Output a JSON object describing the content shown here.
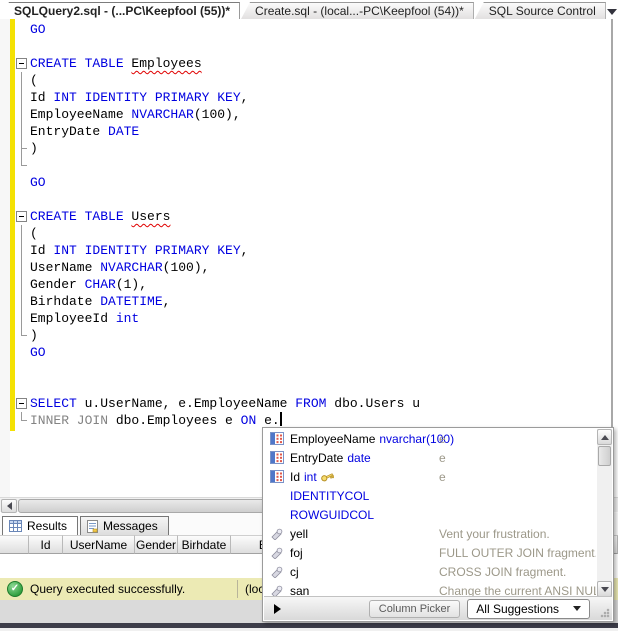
{
  "tab_strip": {
    "tabs": [
      {
        "label": "SQLQuery2.sql - (...PC\\Keepfool (55))*",
        "active": true
      },
      {
        "label": "Create.sql - (local...-PC\\Keepfool (54))*",
        "active": false
      },
      {
        "label": "SQL Source Control",
        "active": false
      }
    ]
  },
  "editor": {
    "lines": [
      {
        "fold": "",
        "seg": [
          [
            "GO",
            "kw"
          ]
        ]
      },
      {
        "fold": "",
        "seg": []
      },
      {
        "fold": "minus",
        "seg": [
          [
            "CREATE TABLE ",
            "kw"
          ],
          [
            "Employees",
            "err"
          ]
        ]
      },
      {
        "fold": "line",
        "seg": [
          [
            "(",
            "pl"
          ]
        ]
      },
      {
        "fold": "line",
        "seg": [
          [
            "Id ",
            "pl"
          ],
          [
            "INT IDENTITY PRIMARY KEY",
            "kw"
          ],
          [
            ",",
            "pl"
          ]
        ]
      },
      {
        "fold": "line",
        "seg": [
          [
            "EmployeeName ",
            "pl"
          ],
          [
            "NVARCHAR",
            "kw"
          ],
          [
            "(100),",
            "pl"
          ]
        ]
      },
      {
        "fold": "line",
        "seg": [
          [
            "EntryDate ",
            "pl"
          ],
          [
            "DATE",
            "kw"
          ]
        ]
      },
      {
        "fold": "tick",
        "seg": [
          [
            ")",
            "pl"
          ]
        ]
      },
      {
        "fold": "end",
        "seg": []
      },
      {
        "fold": "",
        "seg": [
          [
            "GO",
            "kw"
          ]
        ]
      },
      {
        "fold": "",
        "seg": []
      },
      {
        "fold": "minus",
        "seg": [
          [
            "CREATE TABLE ",
            "kw"
          ],
          [
            "Users",
            "err"
          ]
        ]
      },
      {
        "fold": "line",
        "seg": [
          [
            "(",
            "pl"
          ]
        ]
      },
      {
        "fold": "line",
        "seg": [
          [
            "Id ",
            "pl"
          ],
          [
            "INT IDENTITY PRIMARY KEY",
            "kw"
          ],
          [
            ",",
            "pl"
          ]
        ]
      },
      {
        "fold": "line",
        "seg": [
          [
            "UserName ",
            "pl"
          ],
          [
            "NVARCHAR",
            "kw"
          ],
          [
            "(100),",
            "pl"
          ]
        ]
      },
      {
        "fold": "line",
        "seg": [
          [
            "Gender ",
            "pl"
          ],
          [
            "CHAR",
            "kw"
          ],
          [
            "(1),",
            "pl"
          ]
        ]
      },
      {
        "fold": "line",
        "seg": [
          [
            "Birhdate ",
            "pl"
          ],
          [
            "DATETIME",
            "kw"
          ],
          [
            ",",
            "pl"
          ]
        ]
      },
      {
        "fold": "line",
        "seg": [
          [
            "EmployeeId ",
            "pl"
          ],
          [
            "int",
            "kw"
          ]
        ]
      },
      {
        "fold": "end",
        "seg": [
          [
            ")",
            "pl"
          ]
        ]
      },
      {
        "fold": "",
        "seg": [
          [
            "GO",
            "kw"
          ]
        ]
      },
      {
        "fold": "",
        "seg": []
      },
      {
        "fold": "",
        "seg": []
      },
      {
        "fold": "minus",
        "seg": [
          [
            "SELECT ",
            "kw"
          ],
          [
            "u.UserName, e.EmployeeName ",
            "pl"
          ],
          [
            "FROM ",
            "kw"
          ],
          [
            "dbo.Users u",
            "pl"
          ]
        ]
      },
      {
        "fold": "end",
        "seg": [
          [
            "INNER JOIN ",
            "gy"
          ],
          [
            "dbo.Employees e ",
            "pl"
          ],
          [
            "ON ",
            "kw"
          ],
          [
            "e.",
            "err"
          ]
        ],
        "caret": true
      }
    ]
  },
  "autocomplete": {
    "items": [
      {
        "icon": "column",
        "name": "EmployeeName",
        "type": "nvarchar(100)",
        "desc": "e"
      },
      {
        "icon": "column",
        "name": "EntryDate",
        "type": "date",
        "desc": "e"
      },
      {
        "icon": "column",
        "name": "Id",
        "type": "int",
        "key": true,
        "desc": "e"
      },
      {
        "icon": "none",
        "name": "IDENTITYCOL",
        "keyword": true
      },
      {
        "icon": "none",
        "name": "ROWGUIDCOL",
        "keyword": true
      },
      {
        "icon": "snippet",
        "name": "yell",
        "desc": "Vent your frustration."
      },
      {
        "icon": "snippet",
        "name": "foj",
        "desc": "FULL OUTER JOIN fragment."
      },
      {
        "icon": "snippet",
        "name": "cj",
        "desc": "CROSS JOIN fragment."
      },
      {
        "icon": "snippet",
        "name": "san",
        "desc": "Change the current ANSI NUL"
      }
    ],
    "column_picker_label": "Column Picker",
    "filter_label": "All Suggestions"
  },
  "results": {
    "tabs": [
      {
        "label": "Results"
      },
      {
        "label": "Messages"
      }
    ],
    "columns": [
      {
        "label": "",
        "w": 29
      },
      {
        "label": "Id",
        "w": 34
      },
      {
        "label": "UserName",
        "w": 72
      },
      {
        "label": "Gender",
        "w": 43
      },
      {
        "label": "Birhdate",
        "w": 53
      },
      {
        "label": "EmployeeId",
        "w": 120
      }
    ]
  },
  "status_bar": {
    "message": "Query executed successfully.",
    "server": "(local) ("
  },
  "colors": {
    "keyword_blue": "#0000e0",
    "gray_keyword": "#838383",
    "change_bar_yellow": "#f4e103",
    "status_bar_bg": "#eceab4",
    "squiggle_red": "#e00000"
  }
}
